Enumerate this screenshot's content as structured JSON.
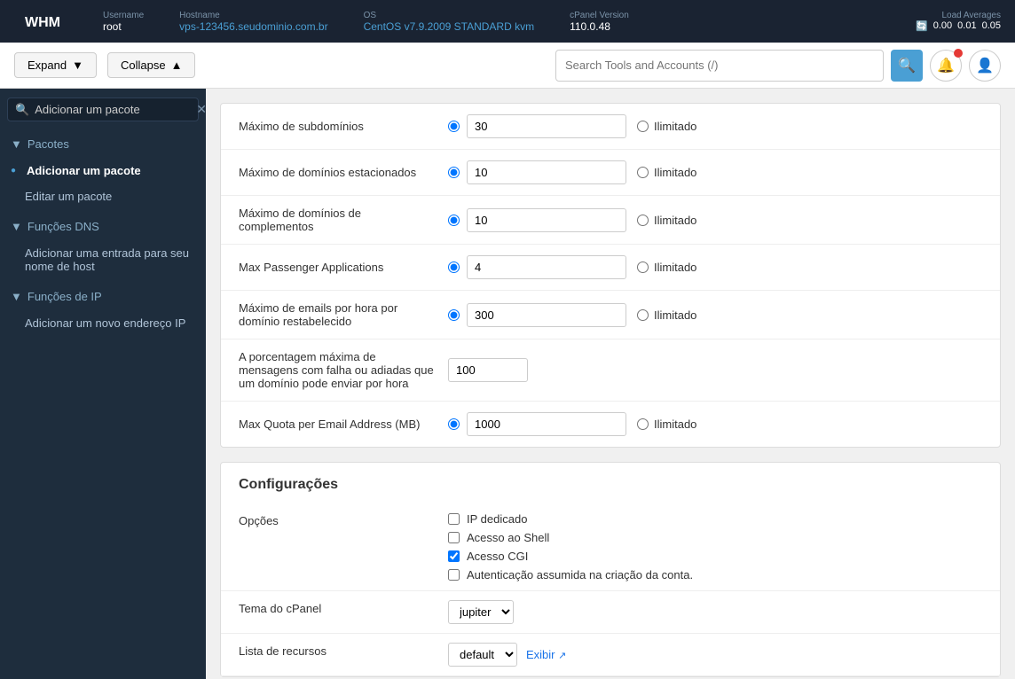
{
  "topbar": {
    "logo_text": "WHM",
    "username_label": "Username",
    "username_value": "root",
    "hostname_label": "Hostname",
    "hostname_value": "vps-123456.seudominio.com.br",
    "os_label": "OS",
    "os_value": "CentOS v7.9.2009 STANDARD kvm",
    "cpanel_label": "cPanel Version",
    "cpanel_value": "110.0.48",
    "load_label": "Load Averages",
    "load_values": [
      "0.00",
      "0.01",
      "0.05"
    ]
  },
  "actionbar": {
    "expand_label": "Expand",
    "collapse_label": "Collapse",
    "search_placeholder": "Search Tools and Accounts (/)"
  },
  "sidebar": {
    "search_value": "Adicionar um pacote",
    "sections": [
      {
        "label": "Pacotes",
        "items": [
          {
            "label": "Adicionar um pacote",
            "active": true
          },
          {
            "label": "Editar um pacote",
            "active": false
          }
        ]
      },
      {
        "label": "Funções DNS",
        "items": [
          {
            "label": "Adicionar uma entrada para seu nome de host",
            "active": false
          }
        ]
      },
      {
        "label": "Funções de IP",
        "items": [
          {
            "label": "Adicionar um novo endereço IP",
            "active": false
          }
        ]
      }
    ]
  },
  "form": {
    "rows": [
      {
        "label": "Máximo de subdomínios",
        "radio_selected": "value",
        "input_value": "30",
        "unlimited_label": "Ilimitado"
      },
      {
        "label": "Máximo de domínios estacionados",
        "radio_selected": "value",
        "input_value": "10",
        "unlimited_label": "Ilimitado"
      },
      {
        "label": "Máximo de domínios de complementos",
        "radio_selected": "value",
        "input_value": "10",
        "unlimited_label": "Ilimitado"
      },
      {
        "label": "Max Passenger Applications",
        "radio_selected": "value",
        "input_value": "4",
        "unlimited_label": "Ilimitado"
      },
      {
        "label": "Máximo de emails por hora por domínio restabelecido",
        "radio_selected": "value",
        "input_value": "300",
        "unlimited_label": "Ilimitado"
      },
      {
        "label": "A porcentagem máxima de mensagens com falha ou adiadas que um domínio pode enviar por hora",
        "radio_selected": "none",
        "input_value": "100",
        "unlimited_label": ""
      },
      {
        "label": "Max Quota per Email Address (MB)",
        "radio_selected": "value",
        "input_value": "1000",
        "unlimited_label": "Ilimitado"
      }
    ]
  },
  "configuracoes": {
    "title": "Configurações",
    "options_label": "Opções",
    "checkboxes": [
      {
        "label": "IP dedicado",
        "checked": false
      },
      {
        "label": "Acesso ao Shell",
        "checked": false
      },
      {
        "label": "Acesso CGI",
        "checked": true
      },
      {
        "label": "Autenticação assumida na criação da conta.",
        "checked": false
      }
    ],
    "tema_label": "Tema do cPanel",
    "tema_options": [
      "jupiter"
    ],
    "tema_selected": "jupiter",
    "lista_label": "Lista de recursos",
    "lista_options": [
      "default"
    ],
    "lista_selected": "default",
    "exibir_label": "Exibir"
  }
}
